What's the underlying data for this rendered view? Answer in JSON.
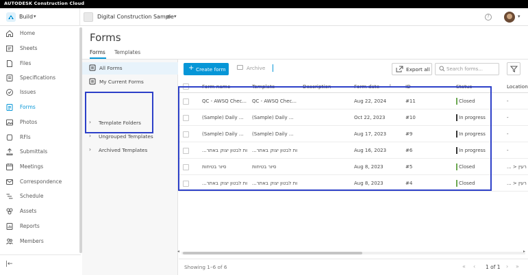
{
  "brand": "AUTODESK Construction Cloud",
  "topbar": {
    "product": "Build",
    "project": "Digital Construction Sample",
    "help": "?"
  },
  "sidebar": {
    "items": [
      {
        "label": "Home",
        "icon": "home-icon"
      },
      {
        "label": "Sheets",
        "icon": "sheets-icon"
      },
      {
        "label": "Files",
        "icon": "files-icon"
      },
      {
        "label": "Specifications",
        "icon": "specifications-icon"
      },
      {
        "label": "Issues",
        "icon": "issues-icon"
      },
      {
        "label": "Forms",
        "icon": "forms-icon",
        "active": true
      },
      {
        "label": "Photos",
        "icon": "photos-icon"
      },
      {
        "label": "RFIs",
        "icon": "rfis-icon"
      },
      {
        "label": "Submittals",
        "icon": "submittals-icon"
      },
      {
        "label": "Meetings",
        "icon": "meetings-icon"
      },
      {
        "label": "Correspondence",
        "icon": "correspondence-icon"
      },
      {
        "label": "Schedule",
        "icon": "schedule-icon"
      },
      {
        "label": "Assets",
        "icon": "assets-icon"
      },
      {
        "label": "Reports",
        "icon": "reports-icon"
      },
      {
        "label": "Members",
        "icon": "members-icon"
      }
    ]
  },
  "page": {
    "title": "Forms",
    "tabs": [
      "Forms",
      "Templates"
    ]
  },
  "left_panel": {
    "all_forms": "All Forms",
    "my_current_forms": "My Current Forms",
    "template_folders": "Template Folders",
    "ungrouped_templates": "Ungrouped Templates",
    "archived_templates": "Archived Templates"
  },
  "toolbar": {
    "create_label": "Create form",
    "archive_label": "Archive",
    "export_label": "Export all",
    "search_placeholder": "Search forms..."
  },
  "table": {
    "columns": [
      "Form name",
      "Template",
      "Description",
      "Form date",
      "ID",
      "Status",
      "Location"
    ],
    "rows": [
      {
        "name": "QC - AWSQ Chec...",
        "template": "QC - AWSQ Chec...",
        "description": "",
        "date": "Aug 22, 2024",
        "id": "#11",
        "status": "Closed",
        "location": "-"
      },
      {
        "name": "(Sample) Daily ...",
        "template": "(Sample) Daily ...",
        "description": "",
        "date": "Oct 22, 2023",
        "id": "#10",
        "status": "In progress",
        "location": "-"
      },
      {
        "name": "(Sample) Daily ...",
        "template": "(Sample) Daily ...",
        "description": "",
        "date": "Aug 17, 2023",
        "id": "#9",
        "status": "In progress",
        "location": "-"
      },
      {
        "name": "...ות לבטון יצוק באתר",
        "template": "...ות לבטון יצוק באתר",
        "description": "",
        "date": "Aug 16, 2023",
        "id": "#6",
        "status": "In progress",
        "location": "-"
      },
      {
        "name": "סיור בטיחות",
        "template": "סיור בטיחות",
        "description": "",
        "date": "Aug 8, 2023",
        "id": "#5",
        "status": "Closed",
        "location": "... > רעין"
      },
      {
        "name": "...ות לבטון יצוק באתר",
        "template": "...ות לבטון יצוק באתר",
        "description": "",
        "date": "Aug 8, 2023",
        "id": "#4",
        "status": "Closed",
        "location": "... > רעין"
      }
    ]
  },
  "footer": {
    "showing": "Showing 1–6 of 6",
    "page_of": "1 of 1"
  },
  "colors": {
    "accent": "#0696d7",
    "closed": "#6aa84f",
    "in_progress": "#333333",
    "highlight": "#2c3fc8"
  }
}
